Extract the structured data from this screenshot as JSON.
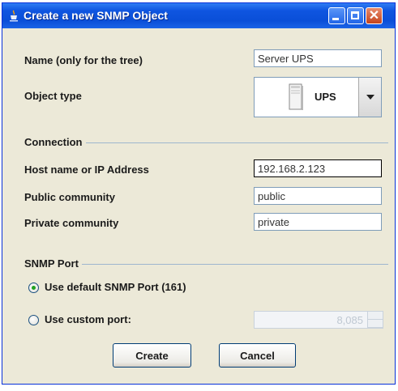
{
  "window": {
    "title": "Create a new SNMP Object"
  },
  "form": {
    "name_label": "Name (only for the tree)",
    "name_value": "Server UPS",
    "object_type_label": "Object type",
    "object_type_value": "UPS",
    "object_type_icon": "ups-device-icon"
  },
  "connection": {
    "section_label": "Connection",
    "host_label": "Host name or IP Address",
    "host_value": "192.168.2.123",
    "public_label": "Public community",
    "public_value": "public",
    "private_label": "Private community",
    "private_value": "private"
  },
  "snmp_port": {
    "section_label": "SNMP Port",
    "default_option_label": "Use default SNMP Port (161)",
    "default_selected": true,
    "custom_option_label": "Use custom port:",
    "custom_port_value": "8,085"
  },
  "buttons": {
    "create_label": "Create",
    "cancel_label": "Cancel"
  },
  "colors": {
    "titlebar": "#0A4FD8",
    "window_bg": "#ECE9D8",
    "radio_selected": "#21A121"
  }
}
